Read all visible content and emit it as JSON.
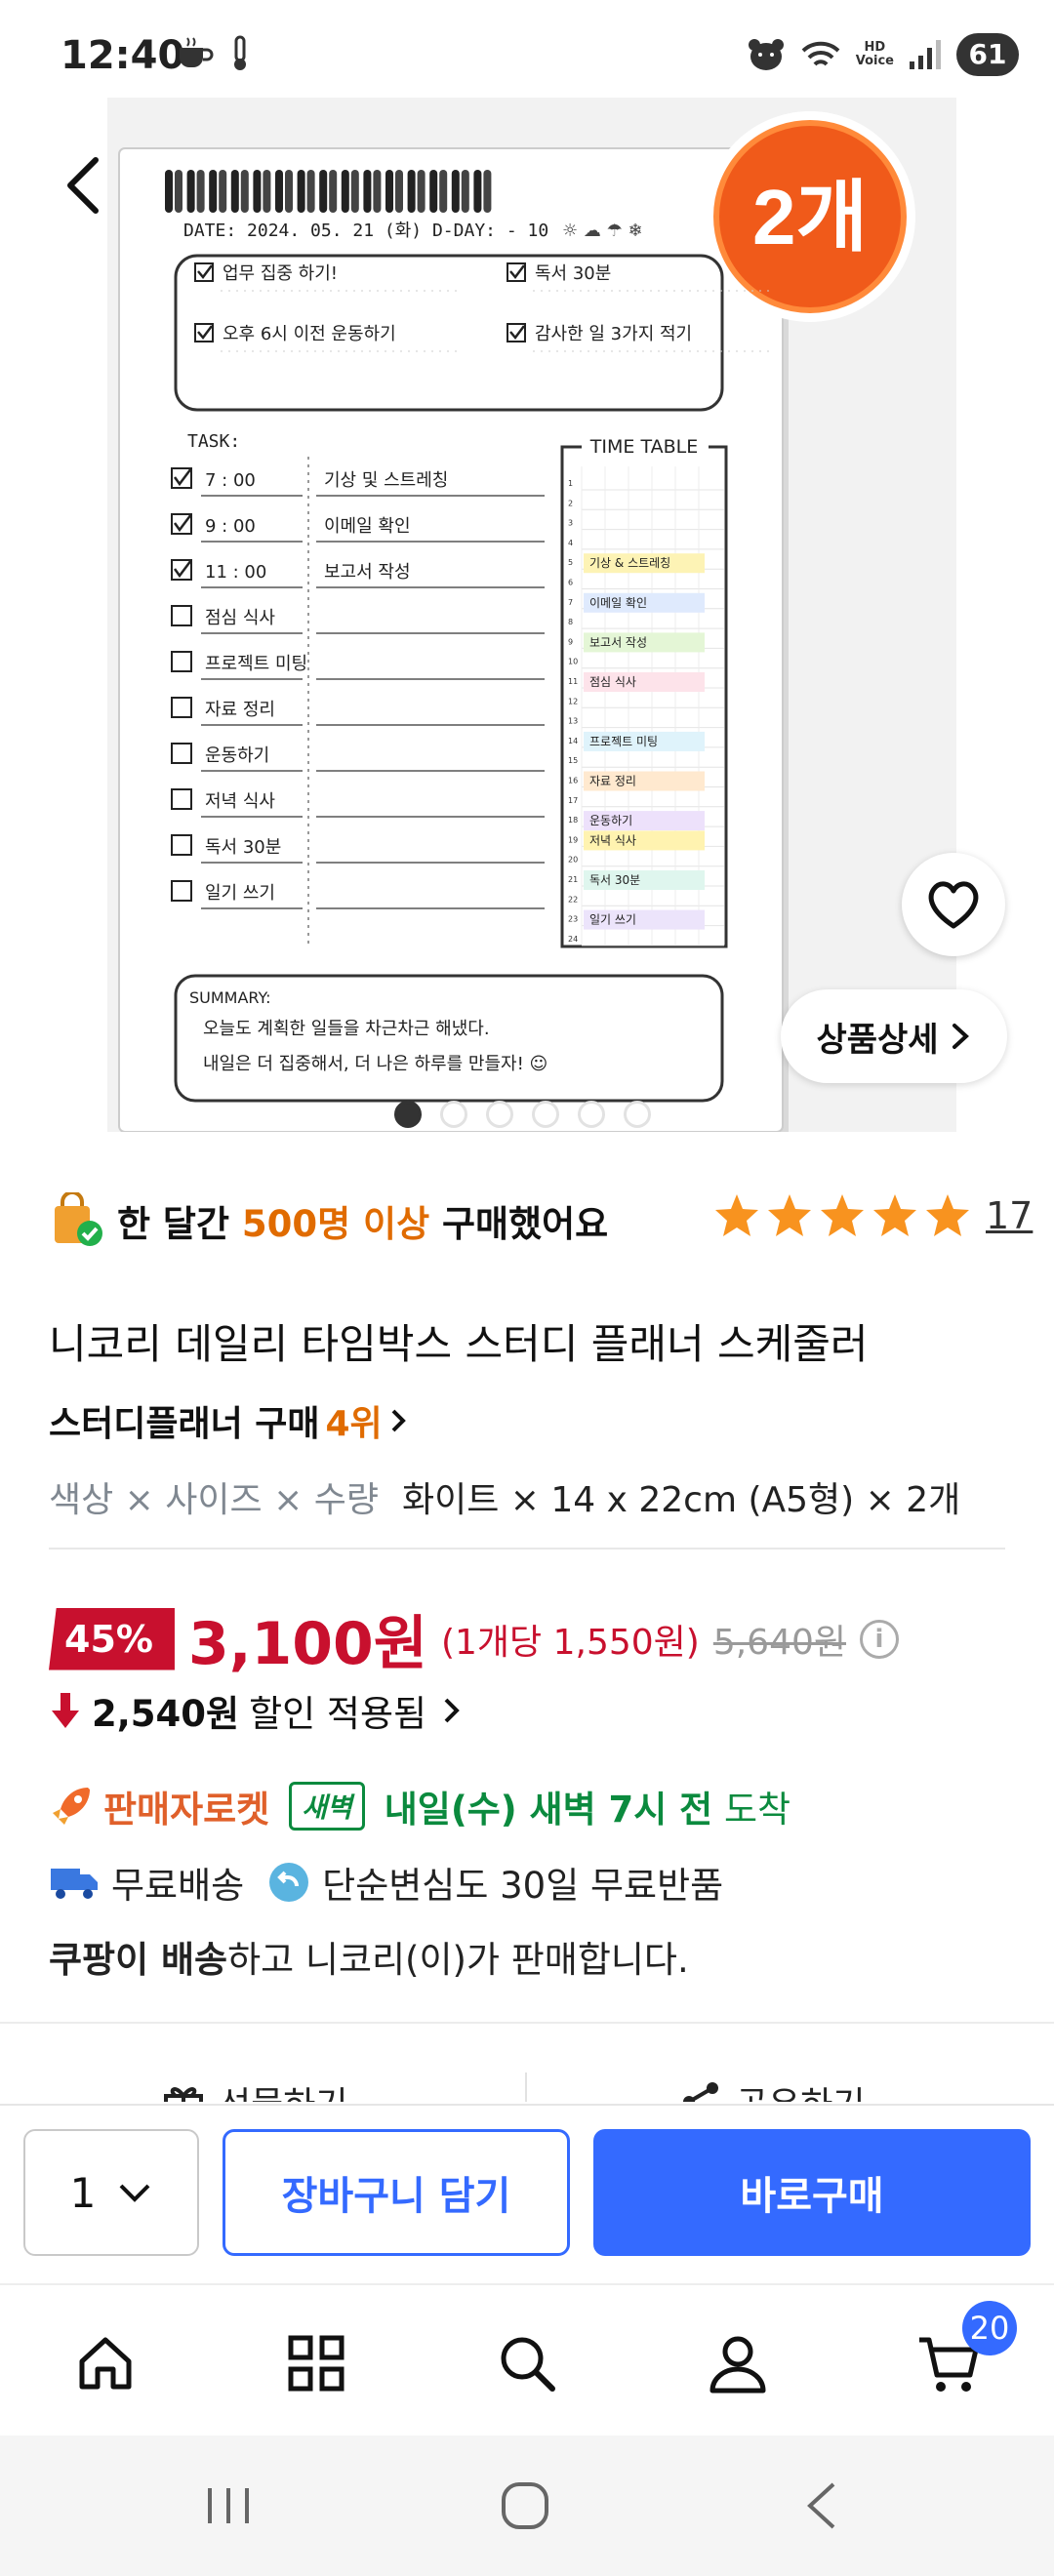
{
  "status_bar": {
    "time": "12:40",
    "battery": "61",
    "hd_voice_label": "HD\nVoice"
  },
  "hero": {
    "badge_text": "2개",
    "planner": {
      "date_line": "DATE: 2024. 05. 21 (화)    D-DAY:  - 10",
      "goals": [
        "업무 집중 하기!",
        "독서 30분",
        "오후 6시 이전 운동하기",
        "감사한 일 3가지 적기"
      ],
      "task_header": "TASK:",
      "timetable_header": "TIME TABLE",
      "tasks": [
        {
          "time": "7 : 00",
          "text": "기상 및 스트레칭",
          "checked": true
        },
        {
          "time": "9 : 00",
          "text": "이메일 확인",
          "checked": true
        },
        {
          "time": "11 : 00",
          "text": "보고서 작성",
          "checked": true
        },
        {
          "time": "점심 식사",
          "text": "",
          "checked": false
        },
        {
          "time": "프로젝트 미팅",
          "text": "",
          "checked": false
        },
        {
          "time": "자료 정리",
          "text": "",
          "checked": false
        },
        {
          "time": "운동하기",
          "text": "",
          "checked": false
        },
        {
          "time": "저녁 식사",
          "text": "",
          "checked": false
        },
        {
          "time": "독서 30분",
          "text": "",
          "checked": false
        },
        {
          "time": "일기 쓰기",
          "text": "",
          "checked": false
        }
      ],
      "timetable_items": [
        "기상 & 스트레칭",
        "이메일 확인",
        "보고서 작성",
        "점심 식사",
        "프로젝트 미팅",
        "자료 정리",
        "운동하기",
        "저녁 식사",
        "독서 30분",
        "일기 쓰기"
      ],
      "timetable_hours": [
        "1",
        "2",
        "3",
        "4",
        "5",
        "6",
        "7",
        "8",
        "9",
        "10",
        "11",
        "12",
        "13",
        "14",
        "15",
        "16",
        "17",
        "18",
        "19",
        "20",
        "21",
        "22",
        "23",
        "24"
      ],
      "summary_header": "SUMMARY:",
      "summary_lines": [
        "오늘도 계획한 일들을 차근차근 해냈다.",
        "내일은 더 집중해서, 더 나은 하루를 만들자! ☺"
      ]
    },
    "detail_button": "상품상세",
    "image_count": 6,
    "active_image": 1
  },
  "proof": {
    "prefix": "한 달간 ",
    "highlight": "500명 이상",
    "suffix": " 구매했어요"
  },
  "rating": {
    "stars": 5,
    "review_count": "17"
  },
  "product": {
    "title": "니코리 데일리 타임박스 스터디 플래너 스케줄러",
    "rank_label": "스터디플래너 구매 ",
    "rank_num": "4위",
    "option_label": "색상 × 사이즈 × 수량",
    "option_value": "화이트 × 14 x 22cm (A5형) × 2개"
  },
  "price": {
    "discount": "45%",
    "sale": "3,100원",
    "per_unit": "(1개당 1,550원)",
    "original": "5,640원",
    "coupon_amount": "2,540원",
    "coupon_text": " 할인 적용됨"
  },
  "delivery": {
    "rocket_label": "판매자로켓",
    "dawn_badge": "새벽",
    "eta": "내일(수) 새벽 7시 전",
    "arrive": " 도착",
    "free_shipping": "무료배송",
    "free_return": "단순변심도 30일 무료반품",
    "seller_bold": "쿠팡이 배송",
    "seller_rest": "하고 니코리(이)가 판매합니다."
  },
  "peek": {
    "gift": "선물하기",
    "share": "공유하기"
  },
  "buybar": {
    "quantity": "1",
    "cart_label": "장바구니 담기",
    "buy_label": "바로구매"
  },
  "nav": {
    "cart_badge": "20"
  },
  "colors": {
    "accent": "#346aff",
    "price_red": "#c8102e",
    "orange": "#e06b00",
    "green": "#0b8a3e"
  }
}
